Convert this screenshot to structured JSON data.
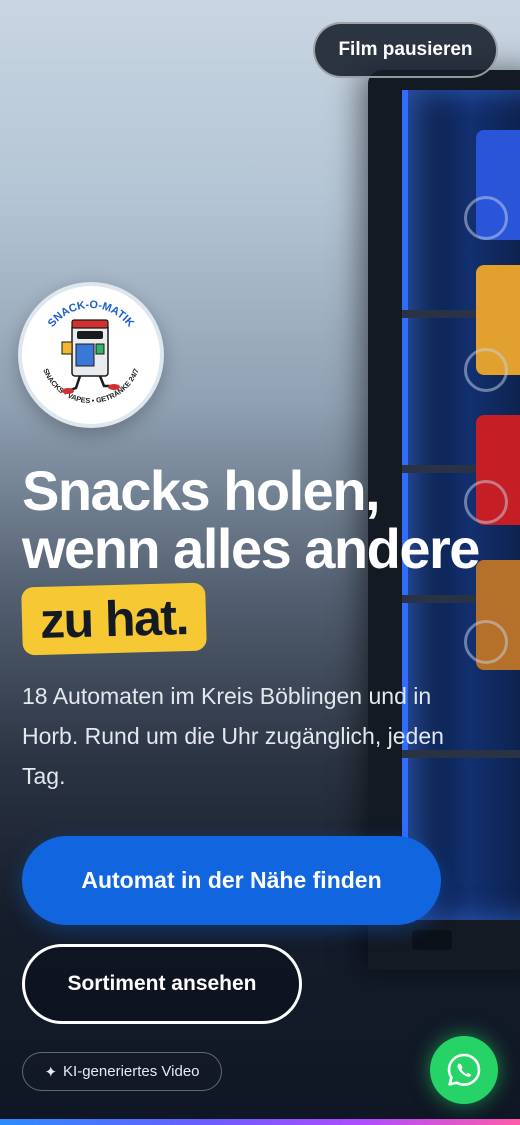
{
  "header": {
    "pause_label": "Film pausieren"
  },
  "logo": {
    "brand_top": "SNACK-O-MATIK",
    "brand_bottom": "SNACKS • VAPES • GETRÄNKE 24/7"
  },
  "hero": {
    "headline_line1": "Snacks holen,",
    "headline_line2": "wenn alles andere",
    "headline_highlight": "zu hat.",
    "subtext": "18 Automaten im Kreis Böblingen und in Horb. Rund um die Uhr zugänglich, jeden Tag."
  },
  "actions": {
    "primary_label": "Automat in der Nähe finden",
    "secondary_label": "Sortiment ansehen"
  },
  "badge": {
    "icon": "sparkle-icon",
    "label": "KI-generiertes Video"
  },
  "floating": {
    "icon": "whatsapp-icon"
  },
  "colors": {
    "accent_blue": "#1166e0",
    "highlight_yellow": "#f6c834",
    "whatsapp_green": "#25d366"
  }
}
